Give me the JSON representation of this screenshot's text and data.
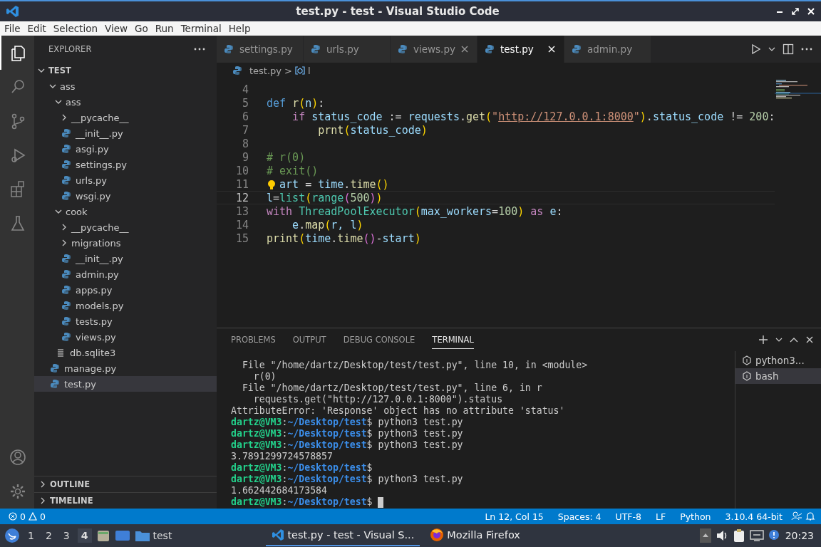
{
  "window": {
    "title": "test.py - test - Visual Studio Code"
  },
  "menu": [
    "File",
    "Edit",
    "Selection",
    "View",
    "Go",
    "Run",
    "Terminal",
    "Help"
  ],
  "activity_bar": [
    {
      "kind": "files",
      "selected": true
    },
    {
      "kind": "search",
      "selected": false
    },
    {
      "kind": "source-control",
      "selected": false
    },
    {
      "kind": "run",
      "selected": false
    },
    {
      "kind": "extensions",
      "selected": false
    },
    {
      "kind": "testing",
      "selected": false
    }
  ],
  "activity_bar_bottom": [
    {
      "kind": "account"
    },
    {
      "kind": "settings"
    }
  ],
  "sidebar": {
    "title": "EXPLORER",
    "root": "TEST",
    "root_expanded": true,
    "tree": [
      {
        "label": "ass",
        "kind": "folder",
        "expanded": true,
        "selected": false,
        "children": [
          {
            "label": "ass",
            "kind": "folder",
            "expanded": true,
            "selected": false,
            "children": [
              {
                "label": "__pycache__",
                "kind": "folder",
                "expanded": false,
                "selected": false
              },
              {
                "label": "__init__.py",
                "kind": "py",
                "selected": false
              },
              {
                "label": "asgi.py",
                "kind": "py",
                "selected": false
              },
              {
                "label": "settings.py",
                "kind": "py",
                "selected": false
              },
              {
                "label": "urls.py",
                "kind": "py",
                "selected": false
              },
              {
                "label": "wsgi.py",
                "kind": "py",
                "selected": false
              }
            ]
          },
          {
            "label": "cook",
            "kind": "folder",
            "expanded": true,
            "selected": false,
            "children": [
              {
                "label": "__pycache__",
                "kind": "folder",
                "expanded": false,
                "selected": false
              },
              {
                "label": "migrations",
                "kind": "folder",
                "expanded": false,
                "selected": false
              },
              {
                "label": "__init__.py",
                "kind": "py",
                "selected": false
              },
              {
                "label": "admin.py",
                "kind": "py",
                "selected": false
              },
              {
                "label": "apps.py",
                "kind": "py",
                "selected": false
              },
              {
                "label": "models.py",
                "kind": "py",
                "selected": false
              },
              {
                "label": "tests.py",
                "kind": "py",
                "selected": false
              },
              {
                "label": "views.py",
                "kind": "py",
                "selected": false
              }
            ]
          },
          {
            "label": "db.sqlite3",
            "kind": "db",
            "selected": false
          }
        ]
      },
      {
        "label": "manage.py",
        "kind": "py",
        "selected": false
      },
      {
        "label": "test.py",
        "kind": "py",
        "selected": true
      }
    ],
    "sections": [
      {
        "label": "OUTLINE",
        "expanded": false
      },
      {
        "label": "TIMELINE",
        "expanded": false
      }
    ]
  },
  "tabs": [
    {
      "label": "settings.py",
      "selected": false,
      "close": false
    },
    {
      "label": "urls.py",
      "selected": false,
      "close": false
    },
    {
      "label": "views.py",
      "selected": false,
      "close": true
    },
    {
      "label": "test.py",
      "selected": true,
      "close": true
    },
    {
      "label": "admin.py",
      "selected": false,
      "close": false
    }
  ],
  "breadcrumb": {
    "file": "test.py",
    "separator": ">",
    "symbol": "l"
  },
  "code": [
    {
      "number": "4",
      "current": false
    },
    {
      "number": "5",
      "current": false,
      "tokens": [
        {
          "text": "def ",
          "kind": "kw"
        },
        {
          "text": "r",
          "kind": "fn"
        },
        {
          "text": "(",
          "kind": "b1"
        },
        {
          "text": "n",
          "kind": "var"
        },
        {
          "text": ")",
          "kind": "b1"
        },
        {
          "text": ":",
          "kind": "p"
        }
      ]
    },
    {
      "number": "6",
      "current": false,
      "tokens": [
        {
          "text": "    if ",
          "kind": "ctrl"
        },
        {
          "text": "status_code",
          "kind": "var"
        },
        {
          "text": " := ",
          "kind": "p"
        },
        {
          "text": "requests",
          "kind": "var"
        },
        {
          "text": ".",
          "kind": "p"
        },
        {
          "text": "get",
          "kind": "fn"
        },
        {
          "text": "(",
          "kind": "b1"
        },
        {
          "text": "\"",
          "kind": "str"
        },
        {
          "text": "http://127.0.0.1:8000",
          "kind": "link"
        },
        {
          "text": "\"",
          "kind": "str"
        },
        {
          "text": ")",
          "kind": "b1"
        },
        {
          "text": ".",
          "kind": "p"
        },
        {
          "text": "status_code",
          "kind": "var"
        },
        {
          "text": " != ",
          "kind": "p"
        },
        {
          "text": "200",
          "kind": "num"
        },
        {
          "text": ":",
          "kind": "p"
        }
      ]
    },
    {
      "number": "7",
      "current": false,
      "tokens": [
        {
          "text": "        prnt",
          "kind": "fn"
        },
        {
          "text": "(",
          "kind": "b1"
        },
        {
          "text": "status_code",
          "kind": "var"
        },
        {
          "text": ")",
          "kind": "b1"
        }
      ]
    },
    {
      "number": "8",
      "current": false
    },
    {
      "number": "9",
      "current": false,
      "tokens": [
        {
          "text": "# r(0)",
          "kind": "cm"
        }
      ]
    },
    {
      "number": "10",
      "current": false,
      "tokens": [
        {
          "text": "# exit()",
          "kind": "cm"
        }
      ]
    },
    {
      "number": "11",
      "current": false,
      "lightbulb": true,
      "tokens": [
        {
          "text": "art",
          "kind": "var"
        },
        {
          "text": " = ",
          "kind": "p"
        },
        {
          "text": "time",
          "kind": "var"
        },
        {
          "text": ".",
          "kind": "p"
        },
        {
          "text": "time",
          "kind": "fn"
        },
        {
          "text": "()",
          "kind": "b1"
        }
      ]
    },
    {
      "number": "12",
      "current": true,
      "tokens": [
        {
          "text": "l",
          "kind": "var"
        },
        {
          "text": "=",
          "kind": "p"
        },
        {
          "text": "list",
          "kind": "cls"
        },
        {
          "text": "(",
          "kind": "b1"
        },
        {
          "text": "range",
          "kind": "cls"
        },
        {
          "text": "(",
          "kind": "b2"
        },
        {
          "text": "500",
          "kind": "num"
        },
        {
          "text": ")",
          "kind": "b2"
        },
        {
          "text": ")",
          "kind": "b1"
        }
      ]
    },
    {
      "number": "13",
      "current": false,
      "tokens": [
        {
          "text": "with ",
          "kind": "ctrl"
        },
        {
          "text": "ThreadPoolExecutor",
          "kind": "cls"
        },
        {
          "text": "(",
          "kind": "b1"
        },
        {
          "text": "max_workers",
          "kind": "var"
        },
        {
          "text": "=",
          "kind": "p"
        },
        {
          "text": "100",
          "kind": "num"
        },
        {
          "text": ")",
          "kind": "b1"
        },
        {
          "text": " as ",
          "kind": "ctrl"
        },
        {
          "text": "e",
          "kind": "var"
        },
        {
          "text": ":",
          "kind": "p"
        }
      ]
    },
    {
      "number": "14",
      "current": false,
      "tokens": [
        {
          "text": "    e",
          "kind": "var"
        },
        {
          "text": ".",
          "kind": "p"
        },
        {
          "text": "map",
          "kind": "fn"
        },
        {
          "text": "(",
          "kind": "b1"
        },
        {
          "text": "r, l",
          "kind": "var"
        },
        {
          "text": ")",
          "kind": "b1"
        }
      ]
    },
    {
      "number": "15",
      "current": false,
      "tokens": [
        {
          "text": "print",
          "kind": "fn"
        },
        {
          "text": "(",
          "kind": "b1"
        },
        {
          "text": "time",
          "kind": "var"
        },
        {
          "text": ".",
          "kind": "p"
        },
        {
          "text": "time",
          "kind": "fn"
        },
        {
          "text": "(",
          "kind": "b2"
        },
        {
          "text": ")",
          "kind": "b2"
        },
        {
          "text": "-",
          "kind": "p"
        },
        {
          "text": "start",
          "kind": "var"
        },
        {
          "text": ")",
          "kind": "b1"
        }
      ]
    }
  ],
  "panel": {
    "tabs": [
      {
        "label": "PROBLEMS",
        "selected": false
      },
      {
        "label": "OUTPUT",
        "selected": false
      },
      {
        "label": "DEBUG CONSOLE",
        "selected": false
      },
      {
        "label": "TERMINAL",
        "selected": true
      }
    ],
    "terminal": [
      {
        "cursor": false,
        "segments": [
          {
            "text": "  File \"/home/dartz/Desktop/test/test.py\", line 10, in <module>",
            "kind": "out"
          }
        ]
      },
      {
        "cursor": false,
        "segments": [
          {
            "text": "    r(0)",
            "kind": "out"
          }
        ]
      },
      {
        "cursor": false,
        "segments": [
          {
            "text": "  File \"/home/dartz/Desktop/test/test.py\", line 6, in r",
            "kind": "out"
          }
        ]
      },
      {
        "cursor": false,
        "segments": [
          {
            "text": "    requests.get(\"http://127.0.0.1:8000\").status",
            "kind": "out"
          }
        ]
      },
      {
        "cursor": false,
        "segments": [
          {
            "text": "AttributeError: 'Response' object has no attribute 'status'",
            "kind": "out"
          }
        ]
      },
      {
        "cursor": false,
        "segments": [
          {
            "text": "dartz@VM3",
            "kind": "user"
          },
          {
            "text": ":",
            "kind": "out"
          },
          {
            "text": "~/Desktop/test",
            "kind": "path"
          },
          {
            "text": "$ python3 test.py",
            "kind": "out"
          }
        ]
      },
      {
        "cursor": false,
        "segments": [
          {
            "text": "dartz@VM3",
            "kind": "user"
          },
          {
            "text": ":",
            "kind": "out"
          },
          {
            "text": "~/Desktop/test",
            "kind": "path"
          },
          {
            "text": "$ python3 test.py",
            "kind": "out"
          }
        ]
      },
      {
        "cursor": false,
        "segments": [
          {
            "text": "dartz@VM3",
            "kind": "user"
          },
          {
            "text": ":",
            "kind": "out"
          },
          {
            "text": "~/Desktop/test",
            "kind": "path"
          },
          {
            "text": "$ python3 test.py",
            "kind": "out"
          }
        ]
      },
      {
        "cursor": false,
        "segments": [
          {
            "text": "3.7891299724578857",
            "kind": "out"
          }
        ]
      },
      {
        "cursor": false,
        "segments": [
          {
            "text": "dartz@VM3",
            "kind": "user"
          },
          {
            "text": ":",
            "kind": "out"
          },
          {
            "text": "~/Desktop/test",
            "kind": "path"
          },
          {
            "text": "$",
            "kind": "out"
          }
        ]
      },
      {
        "cursor": false,
        "segments": [
          {
            "text": "dartz@VM3",
            "kind": "user"
          },
          {
            "text": ":",
            "kind": "out"
          },
          {
            "text": "~/Desktop/test",
            "kind": "path"
          },
          {
            "text": "$ python3 test.py",
            "kind": "out"
          }
        ]
      },
      {
        "cursor": false,
        "segments": [
          {
            "text": "1.662442684173584",
            "kind": "out"
          }
        ]
      },
      {
        "cursor": true,
        "segments": [
          {
            "text": "dartz@VM3",
            "kind": "user"
          },
          {
            "text": ":",
            "kind": "out"
          },
          {
            "text": "~/Desktop/test",
            "kind": "path"
          },
          {
            "text": "$ ",
            "kind": "out"
          }
        ]
      }
    ],
    "terminals": [
      {
        "label": "python3...",
        "selected": false
      },
      {
        "label": "bash",
        "selected": true
      }
    ]
  },
  "status_bar": {
    "errors": "0",
    "warnings": "0",
    "items": [
      "Ln 12, Col 15",
      "Spaces: 4",
      "UTF-8",
      "LF",
      "Python",
      "3.10.4 64-bit"
    ]
  },
  "taskbar": {
    "workspaces": [
      {
        "label": "1",
        "selected": false
      },
      {
        "label": "2",
        "selected": false
      },
      {
        "label": "3",
        "selected": false
      },
      {
        "label": "4",
        "selected": true
      }
    ],
    "folder": "test",
    "tasks": [
      {
        "label": "test.py - test - Visual S...",
        "kind": "vscode",
        "selected": true
      },
      {
        "label": "Mozilla Firefox",
        "kind": "firefox",
        "selected": false
      }
    ],
    "clock": "20:23"
  }
}
